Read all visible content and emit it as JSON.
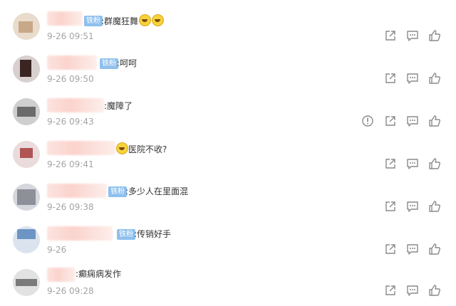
{
  "comments": [
    {
      "badge": "铁粉",
      "text": ":群魔狂舞",
      "time": "9-26 09:51",
      "emoji_count": 2
    },
    {
      "badge": "铁粉",
      "text": ":呵呵",
      "time": "9-26 09:50",
      "emoji_count": 0
    },
    {
      "badge": "",
      "text": ":魔障了",
      "time": "9-26 09:43",
      "emoji_count": 0
    },
    {
      "badge": "",
      "text": "医院不收?",
      "time": "9-26 09:41",
      "emoji_count": 1
    },
    {
      "badge": "铁粉",
      "text": ":多少人在里面混",
      "time": "9-26 09:38",
      "emoji_count": 0
    },
    {
      "badge": "铁粉",
      "text": ":传销好手",
      "time": "9-26",
      "emoji_count": 0
    },
    {
      "badge": "",
      "text": ":癫痫病发作",
      "time": "9-26 09:28",
      "emoji_count": 0
    }
  ],
  "icons": {
    "share": "share-icon",
    "comment": "comment-icon",
    "like": "like-icon",
    "report": "report-icon"
  },
  "colors": {
    "badge": "#8ec0ee",
    "time": "#a4a4a4",
    "text": "#333333",
    "icon": "#8a8a8a"
  }
}
